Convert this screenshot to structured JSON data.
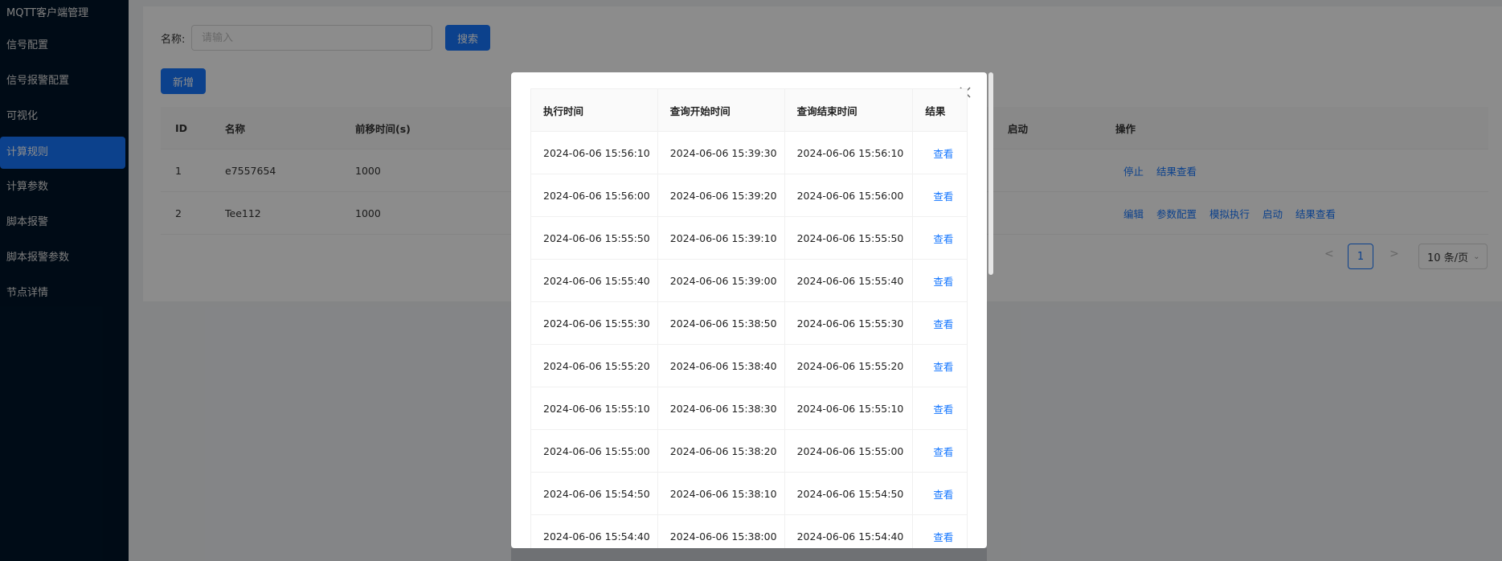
{
  "sidebar": {
    "brand": "MQTT客户端管理",
    "items": [
      {
        "label": "信号配置"
      },
      {
        "label": "信号报警配置"
      },
      {
        "label": "可视化"
      },
      {
        "label": "计算规则"
      },
      {
        "label": "计算参数"
      },
      {
        "label": "脚本报警"
      },
      {
        "label": "脚本报警参数"
      },
      {
        "label": "节点详情"
      }
    ],
    "active_index": 3
  },
  "search": {
    "label": "名称:",
    "placeholder": "请输入",
    "button": "搜索"
  },
  "toolbar": {
    "add_label": "新增"
  },
  "table": {
    "columns": [
      "ID",
      "名称",
      "前移时间(s)",
      "启动",
      "操作"
    ],
    "rows": [
      {
        "id": "1",
        "name": "e7557654",
        "shift": "1000",
        "actions": [
          "停止",
          "结果查看"
        ]
      },
      {
        "id": "2",
        "name": "Tee112",
        "shift": "1000",
        "actions": [
          "编辑",
          "参数配置",
          "模拟执行",
          "启动",
          "结果查看"
        ]
      }
    ]
  },
  "pagination": {
    "prev": "<",
    "current": "1",
    "next": ">",
    "page_size": "10 条/页"
  },
  "modal": {
    "columns": [
      "执行时间",
      "查询开始时间",
      "查询结束时间",
      "结果"
    ],
    "rows": [
      {
        "exec": "2024-06-06 15:56:10",
        "start": "2024-06-06 15:39:30",
        "end": "2024-06-06 15:56:10",
        "result": "查看"
      },
      {
        "exec": "2024-06-06 15:56:00",
        "start": "2024-06-06 15:39:20",
        "end": "2024-06-06 15:56:00",
        "result": "查看"
      },
      {
        "exec": "2024-06-06 15:55:50",
        "start": "2024-06-06 15:39:10",
        "end": "2024-06-06 15:55:50",
        "result": "查看"
      },
      {
        "exec": "2024-06-06 15:55:40",
        "start": "2024-06-06 15:39:00",
        "end": "2024-06-06 15:55:40",
        "result": "查看"
      },
      {
        "exec": "2024-06-06 15:55:30",
        "start": "2024-06-06 15:38:50",
        "end": "2024-06-06 15:55:30",
        "result": "查看"
      },
      {
        "exec": "2024-06-06 15:55:20",
        "start": "2024-06-06 15:38:40",
        "end": "2024-06-06 15:55:20",
        "result": "查看"
      },
      {
        "exec": "2024-06-06 15:55:10",
        "start": "2024-06-06 15:38:30",
        "end": "2024-06-06 15:55:10",
        "result": "查看"
      },
      {
        "exec": "2024-06-06 15:55:00",
        "start": "2024-06-06 15:38:20",
        "end": "2024-06-06 15:55:00",
        "result": "查看"
      },
      {
        "exec": "2024-06-06 15:54:50",
        "start": "2024-06-06 15:38:10",
        "end": "2024-06-06 15:54:50",
        "result": "查看"
      },
      {
        "exec": "2024-06-06 15:54:40",
        "start": "2024-06-06 15:38:00",
        "end": "2024-06-06 15:54:40",
        "result": "查看"
      }
    ]
  },
  "colors": {
    "sidebar_bg": "#001529",
    "primary": "#1677ff"
  }
}
